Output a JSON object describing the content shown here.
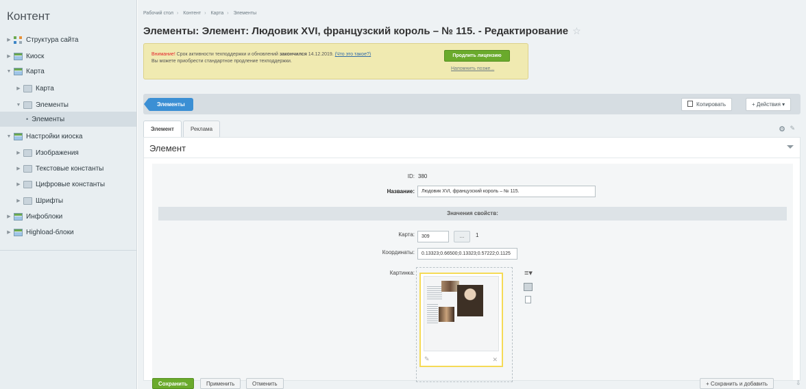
{
  "sidebar": {
    "title": "Контент",
    "items": [
      {
        "label": "Структура сайта",
        "icon": "site-tree-icon"
      },
      {
        "label": "Киоск",
        "icon": "kiosk-icon"
      },
      {
        "label": "Карта",
        "icon": "kiosk-icon"
      },
      {
        "label": "Карта",
        "icon": "folder-icon"
      },
      {
        "label": "Элементы",
        "icon": "folder-icon"
      },
      {
        "label": "Элементы",
        "icon": "bullet-icon"
      },
      {
        "label": "Настройки киоска",
        "icon": "kiosk-icon"
      },
      {
        "label": "Изображения",
        "icon": "folder-icon"
      },
      {
        "label": "Текстовые константы",
        "icon": "folder-icon"
      },
      {
        "label": "Цифровые константы",
        "icon": "folder-icon"
      },
      {
        "label": "Шрифты",
        "icon": "folder-icon"
      },
      {
        "label": "Инфоблоки",
        "icon": "infoblock-icon"
      },
      {
        "label": "Highload-блоки",
        "icon": "infoblock-icon"
      }
    ]
  },
  "breadcrumb": [
    "Рабочий стол",
    "Контент",
    "Карта",
    "Элементы"
  ],
  "page": {
    "title": "Элементы: Элемент: Людовик XVI, французский король – № 115. - Редактирование",
    "star": "☆"
  },
  "notice": {
    "warn": "Внимание!",
    "text1": " Срок активности техподдержки и обновлений ",
    "bold": "закончился",
    "date": " 14.12.2019. ",
    "link": "(Что это такое?)",
    "line2": "Вы можете приобрести стандартное продление техподдержки.",
    "button": "Продлить лицензию",
    "later": "Напомнить позже..."
  },
  "toolbar": {
    "tag": "Элементы",
    "copy": "Копировать",
    "actions": "+ Действия ▾"
  },
  "tabs": [
    {
      "label": "Элемент",
      "active": true
    },
    {
      "label": "Реклама",
      "active": false
    }
  ],
  "card": {
    "title": "Элемент"
  },
  "form": {
    "id_label": "ID:",
    "id_value": "380",
    "name_label": "Название:",
    "name_value": "Людовик XVI, французский король – № 115.",
    "props_header": "Значения свойств:",
    "map_label": "Карта:",
    "map_value": "309",
    "map_btn": "...",
    "map_count": "1",
    "coords_label": "Координаты:",
    "coords_value": "0.13323;0.66500;0.13323;0.57222;0.1125",
    "pic_label": "Картинка:"
  },
  "footer": {
    "save": "Сохранить",
    "apply": "Применить",
    "cancel": "Отменить",
    "save_add": "+ Сохранить и добавить"
  },
  "colors": {
    "accent": "#3b8fd4",
    "save_green": "#6aaa2c",
    "notice_bg": "#f0eab1",
    "warn_red": "#e4272c"
  }
}
